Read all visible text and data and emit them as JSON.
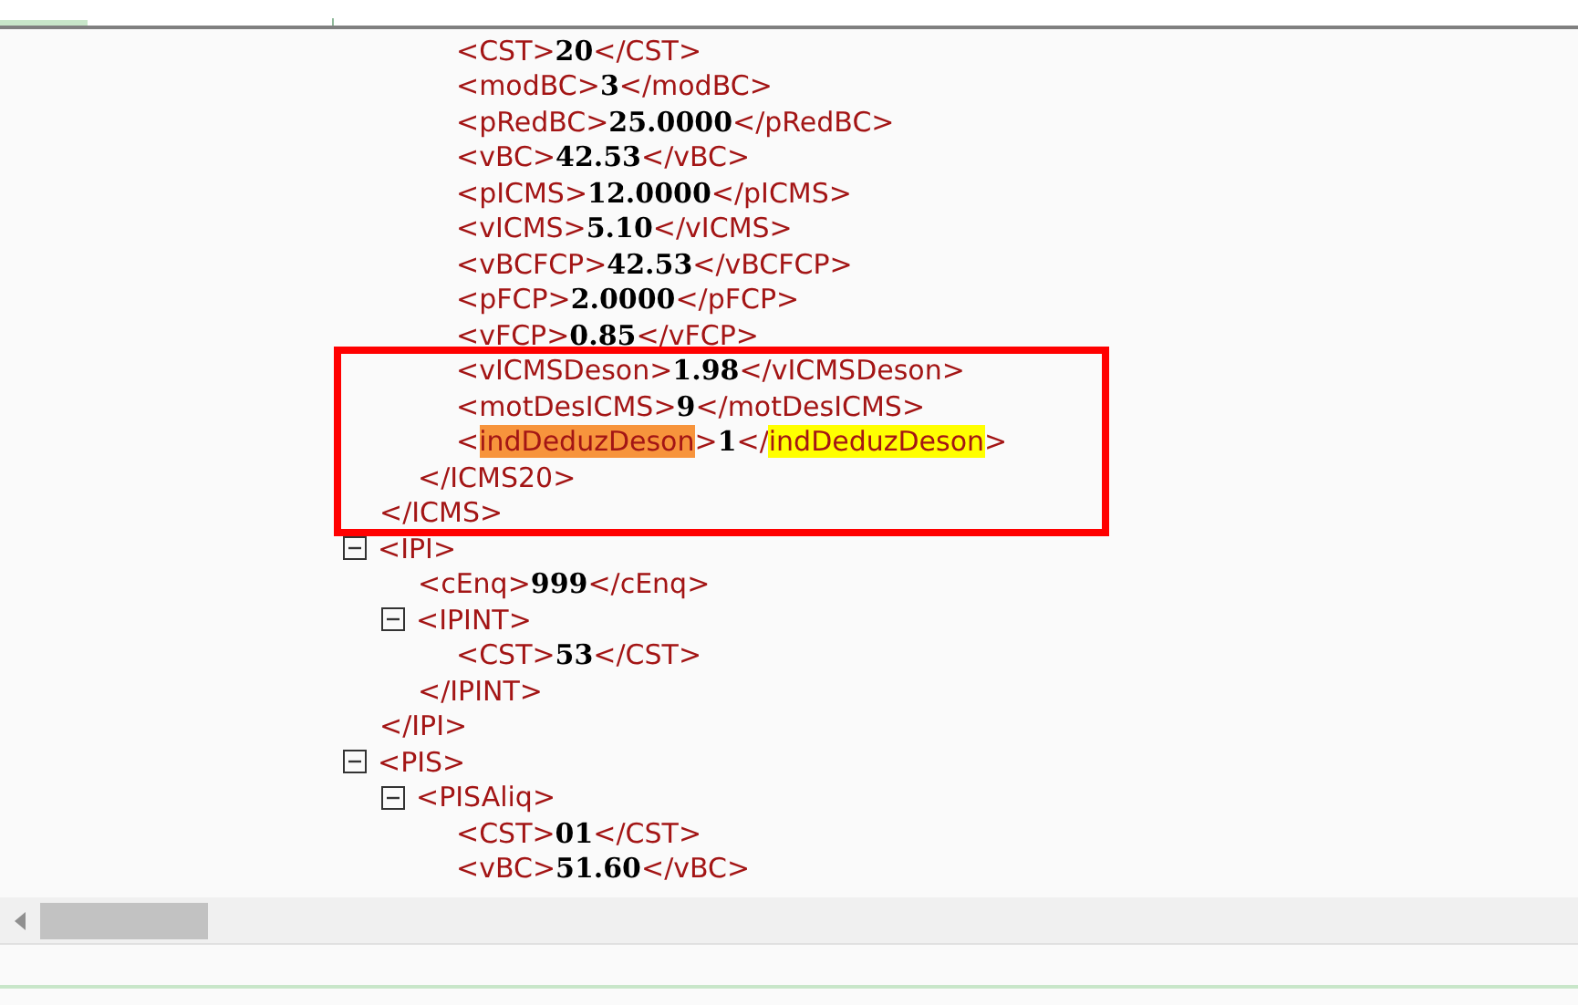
{
  "document": {
    "nodes": [
      {
        "kind": "element",
        "children": [
          {
            "kind": "element",
            "children": [
              {
                "kind": "leaf",
                "open": [
                  {
                    "text": "<CST>"
                  }
                ],
                "value": "20",
                "close": [
                  {
                    "text": "</CST>"
                  }
                ]
              },
              {
                "kind": "leaf",
                "open": [
                  {
                    "text": "<modBC>"
                  }
                ],
                "value": "3",
                "close": [
                  {
                    "text": "</modBC>"
                  }
                ]
              },
              {
                "kind": "leaf",
                "open": [
                  {
                    "text": "<pRedBC>"
                  }
                ],
                "value": "25.0000",
                "close": [
                  {
                    "text": "</pRedBC>"
                  }
                ]
              },
              {
                "kind": "leaf",
                "open": [
                  {
                    "text": "<vBC>"
                  }
                ],
                "value": "42.53",
                "close": [
                  {
                    "text": "</vBC>"
                  }
                ]
              },
              {
                "kind": "leaf",
                "open": [
                  {
                    "text": "<pICMS>"
                  }
                ],
                "value": "12.0000",
                "close": [
                  {
                    "text": "</pICMS>"
                  }
                ]
              },
              {
                "kind": "leaf",
                "open": [
                  {
                    "text": "<vICMS>"
                  }
                ],
                "value": "5.10",
                "close": [
                  {
                    "text": "</vICMS>"
                  }
                ]
              },
              {
                "kind": "leaf",
                "open": [
                  {
                    "text": "<vBCFCP>"
                  }
                ],
                "value": "42.53",
                "close": [
                  {
                    "text": "</vBCFCP>"
                  }
                ]
              },
              {
                "kind": "leaf",
                "open": [
                  {
                    "text": "<pFCP>"
                  }
                ],
                "value": "2.0000",
                "close": [
                  {
                    "text": "</pFCP>"
                  }
                ]
              },
              {
                "kind": "leaf",
                "open": [
                  {
                    "text": "<vFCP>"
                  }
                ],
                "value": "0.85",
                "close": [
                  {
                    "text": "</vFCP>"
                  }
                ]
              },
              {
                "kind": "leaf",
                "open": [
                  {
                    "text": "<vICMSDeson>"
                  }
                ],
                "value": "1.98",
                "close": [
                  {
                    "text": "</vICMSDeson>"
                  }
                ]
              },
              {
                "kind": "leaf",
                "open": [
                  {
                    "text": "<motDesICMS>"
                  }
                ],
                "value": "9",
                "close": [
                  {
                    "text": "</motDesICMS>"
                  }
                ]
              },
              {
                "kind": "leaf",
                "open": [
                  {
                    "text": "<"
                  },
                  {
                    "text": "indDeduzDeson",
                    "color": "#f7943c"
                  },
                  {
                    "text": ">"
                  }
                ],
                "value": "1",
                "close": [
                  {
                    "text": "</"
                  },
                  {
                    "text": "indDeduzDeson",
                    "color": "#ffff00"
                  },
                  {
                    "text": ">"
                  }
                ]
              }
            ],
            "close": "</ICMS20>"
          }
        ],
        "close": "</ICMS>"
      },
      {
        "kind": "element",
        "open": "<IPI>",
        "expanded": true,
        "children": [
          {
            "kind": "leaf",
            "open": [
              {
                "text": "<cEnq>"
              }
            ],
            "value": "999",
            "close": [
              {
                "text": "</cEnq>"
              }
            ]
          },
          {
            "kind": "element",
            "open": "<IPINT>",
            "expanded": true,
            "children": [
              {
                "kind": "leaf",
                "open": [
                  {
                    "text": "<CST>"
                  }
                ],
                "value": "53",
                "close": [
                  {
                    "text": "</CST>"
                  }
                ]
              }
            ],
            "close": "</IPINT>"
          }
        ],
        "close": "</IPI>"
      },
      {
        "kind": "element",
        "open": "<PIS>",
        "expanded": true,
        "children": [
          {
            "kind": "element",
            "open": "<PISAliq>",
            "expanded": true,
            "children": [
              {
                "kind": "leaf",
                "open": [
                  {
                    "text": "<CST>"
                  }
                ],
                "value": "01",
                "close": [
                  {
                    "text": "</CST>"
                  }
                ]
              },
              {
                "kind": "leaf",
                "open": [
                  {
                    "text": "<vBC>"
                  }
                ],
                "value": "51.60",
                "close": [
                  {
                    "text": "</vBC>"
                  }
                ]
              }
            ]
          }
        ]
      }
    ]
  }
}
